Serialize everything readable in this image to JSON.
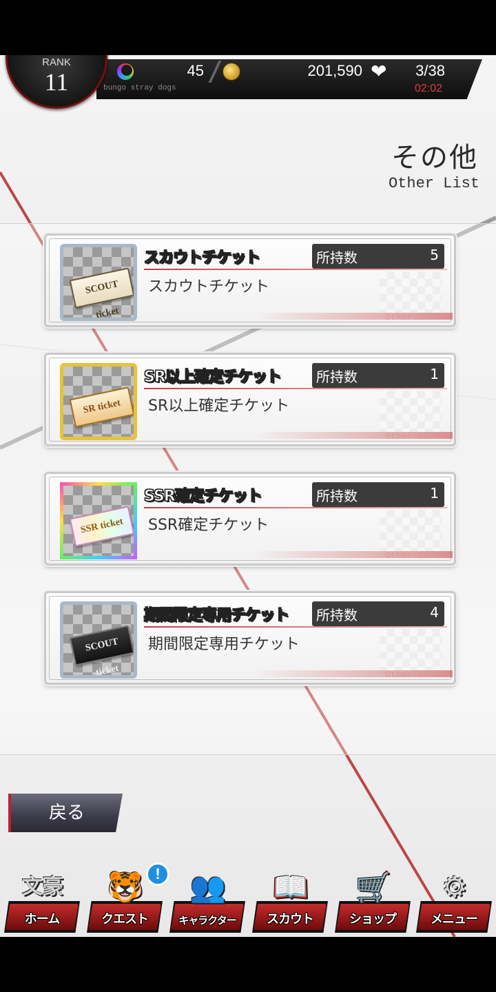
{
  "status": {
    "rank_label": "RANK",
    "rank_value": "11",
    "gems": "45",
    "coins": "201,590",
    "stamina": "3/38",
    "stamina_timer": "02:02",
    "caption": "bungo stray dogs",
    "heart_icon": "heart-ap-icon",
    "gem_icon": "rainbow-moon-icon",
    "coin_icon": "gold-coin-icon"
  },
  "header": {
    "title": "その他",
    "subtitle": "Other List"
  },
  "items": [
    {
      "name": "スカウトチケット",
      "desc": "スカウトチケット",
      "count_label": "所持数",
      "count": "5",
      "ticket_text": "SCOUT ticket",
      "frame": "silver"
    },
    {
      "name": "SR以上確定チケット",
      "desc": "SR以上確定チケット",
      "count_label": "所持数",
      "count": "1",
      "ticket_text": "SR ticket",
      "frame": "gold"
    },
    {
      "name": "SSR確定チケット",
      "desc": "SSR確定チケット",
      "count_label": "所持数",
      "count": "1",
      "ticket_text": "SSR ticket",
      "frame": "rainbow"
    },
    {
      "name": "期間限定専用チケット",
      "desc": "期間限定専用チケット",
      "count_label": "所持数",
      "count": "4",
      "ticket_text": "SCOUT ticket",
      "frame": "silver"
    }
  ],
  "card_footer": "Other List",
  "back_button": "戻る",
  "nav": [
    {
      "label": "ホーム",
      "glyph": "文豪",
      "icon": "home-icon"
    },
    {
      "label": "クエスト",
      "glyph": "🐯",
      "icon": "quest-icon",
      "badge": "!"
    },
    {
      "label": "キャラクター",
      "glyph": "👥",
      "icon": "character-icon"
    },
    {
      "label": "スカウト",
      "glyph": "📖",
      "icon": "scout-icon"
    },
    {
      "label": "ショップ",
      "glyph": "🛒",
      "icon": "shop-icon"
    },
    {
      "label": "メニュー",
      "glyph": "⚙",
      "icon": "menu-gear-icon"
    }
  ],
  "colors": {
    "accent_red": "#c42b2b",
    "count_box": "#3b3b3b",
    "badge_blue": "#1f8fe0"
  }
}
